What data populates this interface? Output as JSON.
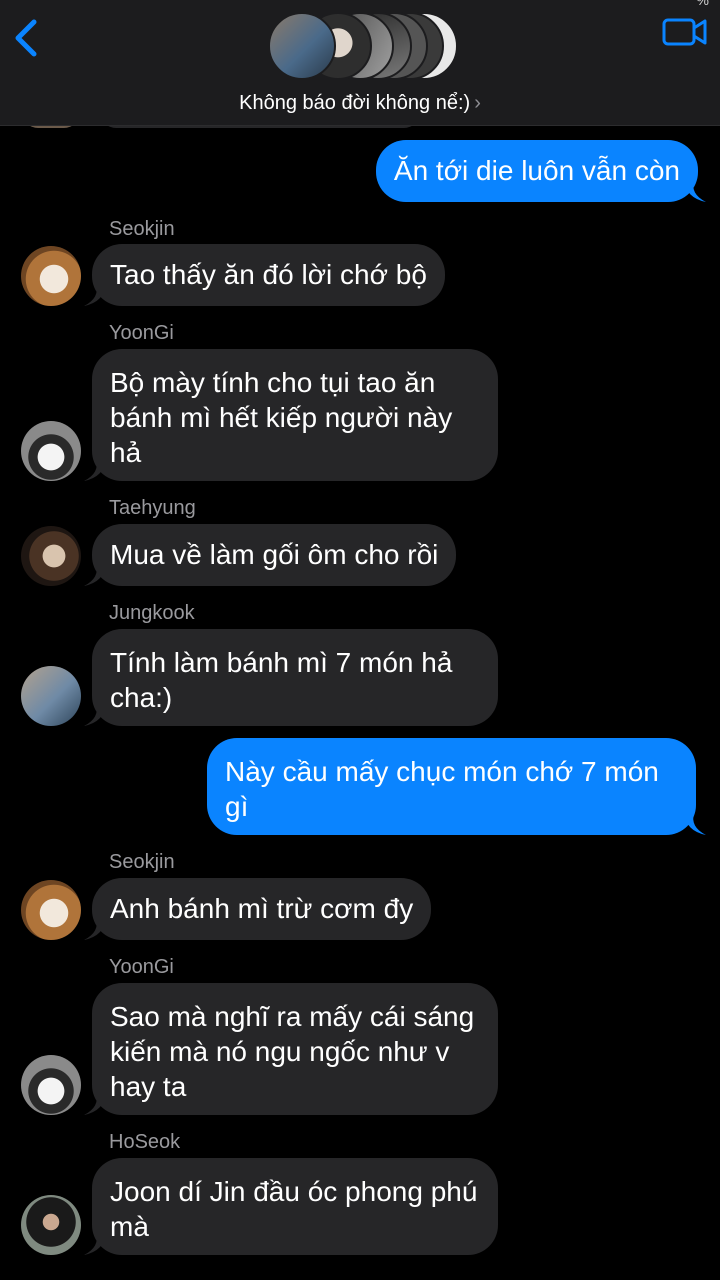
{
  "header": {
    "group_name": "Không báo đời không nể:)",
    "chevron": "›",
    "status_fragment": "%",
    "back_icon": "chevron-left-icon",
    "video_icon": "video-camera-icon",
    "accent_color": "#0a84ff"
  },
  "messages": [
    {
      "direction": "out",
      "text": "Ăn tới die luôn vẫn còn"
    },
    {
      "direction": "in",
      "sender": "Seokjin",
      "text": "Tao thấy ăn đó lời chớ bộ"
    },
    {
      "direction": "in",
      "sender": "YoonGi",
      "text": "Bộ mày tính cho tụi tao ăn bánh mì hết kiếp người này hả"
    },
    {
      "direction": "in",
      "sender": "Taehyung",
      "text": "Mua về làm gối ôm cho rồi"
    },
    {
      "direction": "in",
      "sender": "Jungkook",
      "text": "Tính làm bánh mì 7 món hả cha:)"
    },
    {
      "direction": "out",
      "text": "Này cầu mấy chục món chớ 7 món gì"
    },
    {
      "direction": "in",
      "sender": "Seokjin",
      "text": "Anh bánh mì trừ cơm đy"
    },
    {
      "direction": "in",
      "sender": "YoonGi",
      "text": "Sao mà nghĩ ra mấy cái sáng kiến mà nó ngu ngốc như v hay ta"
    },
    {
      "direction": "in",
      "sender": "HoSeok",
      "text": "Joon dí Jin đầu óc phong phú mà"
    }
  ],
  "colors": {
    "incoming_bubble": "#262628",
    "outgoing_bubble": "#0a84ff",
    "sender_name": "#9a9a9e",
    "background": "#000000"
  }
}
